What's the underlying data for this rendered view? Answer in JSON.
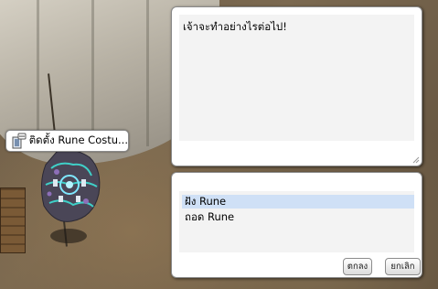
{
  "npc": {
    "name_label": "ติดตั้ง Rune Costu..."
  },
  "dialog": {
    "message": "เจ้าจะทำอย่างไรต่อไป!"
  },
  "menu": {
    "options": [
      {
        "label": "ฝัง Rune",
        "selected": true
      },
      {
        "label": "ถอด Rune",
        "selected": false
      }
    ],
    "ok_label": "ตกลง",
    "cancel_label": "ยกเลิก"
  },
  "colors": {
    "selection_highlight": "#cfe0f6",
    "panel_fill": "#f3f3f3",
    "monster_glow": "#3fd0c8"
  }
}
